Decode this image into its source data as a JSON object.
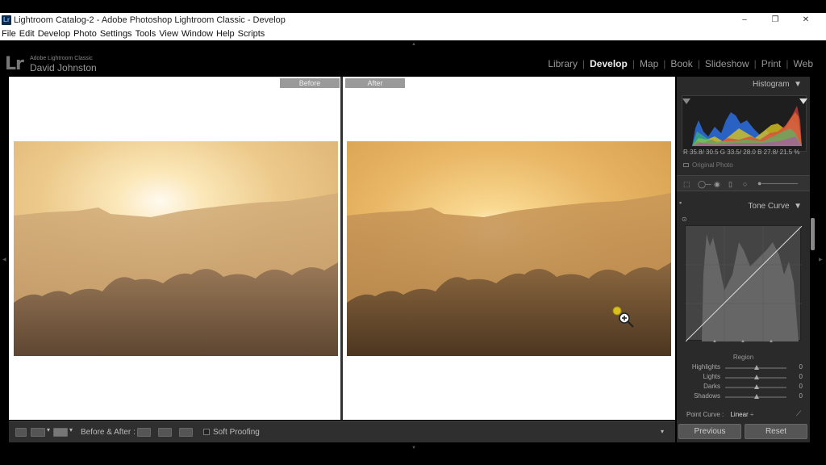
{
  "window": {
    "title": "Lightroom Catalog-2 - Adobe Photoshop Lightroom Classic - Develop",
    "app_icon": "Lr",
    "controls": {
      "minimize": "–",
      "restore": "❐",
      "close": "✕"
    }
  },
  "menu": [
    "File",
    "Edit",
    "Develop",
    "Photo",
    "Settings",
    "Tools",
    "View",
    "Window",
    "Help",
    "Scripts"
  ],
  "header": {
    "logo": "Lr",
    "product": "Adobe Lightroom Classic",
    "user": "David Johnston",
    "modules": [
      "Library",
      "Develop",
      "Map",
      "Book",
      "Slideshow",
      "Print",
      "Web"
    ],
    "active_module": "Develop"
  },
  "view": {
    "before_label": "Before",
    "after_label": "After"
  },
  "toolbar": {
    "before_after_label": "Before & After :",
    "soft_proofing_label": "Soft Proofing"
  },
  "right_panel": {
    "histogram_title": "Histogram",
    "rgb_readout": "R 35.8/ 30.5  G 33.5/ 28.0  B 27.8/ 21.5 %",
    "original_photo": "Original Photo",
    "tone_curve_title": "Tone Curve",
    "region_title": "Region",
    "sliders": [
      {
        "label": "Highlights",
        "value": "0"
      },
      {
        "label": "Lights",
        "value": "0"
      },
      {
        "label": "Darks",
        "value": "0"
      },
      {
        "label": "Shadows",
        "value": "0"
      }
    ],
    "point_curve_label": "Point Curve :",
    "point_curve_value": "Linear",
    "point_curve_arrow": "÷"
  },
  "buttons": {
    "previous": "Previous",
    "reset": "Reset"
  },
  "colors": {
    "accent": "#e8b040",
    "panel_bg": "#2a2a2a",
    "toolbar_bg": "#2f2f2f"
  }
}
